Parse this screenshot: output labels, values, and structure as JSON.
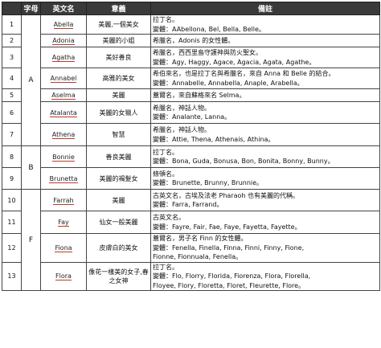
{
  "headers": {
    "num": "",
    "letter": "字母",
    "en": "英文名",
    "meaning": "意義",
    "note": "備註"
  },
  "rows": [
    {
      "num": "1",
      "letter": "A",
      "en": "Abella",
      "meaning": "美麗,一個美女",
      "note": [
        "拉丁名。",
        "變體：AAbellona, Bel, Bella, Belle。"
      ]
    },
    {
      "num": "2",
      "en": "Adonia",
      "meaning": "美麗的小姐",
      "note": [
        "希臘名，Adonis 的女性體。"
      ]
    },
    {
      "num": "3",
      "en": "Agatha",
      "meaning": "美好善良",
      "note": [
        "希臘名，西西里島守護神與防火聖女。",
        "變體：Agy, Haggy, Agace, Agacia, Agata, Agathe。"
      ]
    },
    {
      "num": "4",
      "en": "Annabel",
      "meaning": "高雅的美女",
      "note": [
        "希伯來名，也是拉丁名與希臘名，來自 Anna 和 Belle 的結合。",
        "變體：Annabelle, Annabella, Anaple, Arabella。"
      ]
    },
    {
      "num": "5",
      "en": "Aselma",
      "meaning": "美麗",
      "note": [
        "蓋爾名，來自蘇格來名 Selma。"
      ]
    },
    {
      "num": "6",
      "en": "Atalanta",
      "meaning": "美麗的女獵人",
      "note": [
        "希臘名，神話人物。",
        "變體：Analante, Lanna。"
      ]
    },
    {
      "num": "7",
      "en": "Athena",
      "meaning": "智慧",
      "note": [
        "希臘名，神話人物。",
        "變體：Attie, Thena, Athenais, Athina。"
      ]
    },
    {
      "num": "8",
      "letter": "B",
      "en": "Bonnie",
      "meaning": "善良美麗",
      "note": [
        "拉丁名。",
        "變體：Bona, Guda, Bonusa, Bon, Bonita, Bonny, Bunny。"
      ]
    },
    {
      "num": "9",
      "en": "Brunetta",
      "meaning": "美麗的褐髮女",
      "note": [
        "條頓名。",
        "變體：Brunette, Brunny, Brunnie。"
      ]
    },
    {
      "num": "10",
      "letter": "F",
      "en": "Farrah",
      "meaning": "美麗",
      "note": [
        "古英文名，古埃及法老 Pharaoh 也有美麗的代稱。",
        "變體：Farra, Farrand。"
      ]
    },
    {
      "num": "11",
      "en": "Fay",
      "meaning": "仙女一般美麗",
      "note": [
        "古英文名。",
        "變體：Fayre, Fair, Fae, Faye, Fayetta, Fayette。"
      ]
    },
    {
      "num": "12",
      "en": "Fiona",
      "meaning": "皮膚白的美女",
      "note": [
        "蓋爾名，男子名 Finn 的女性體。",
        "變體：Fenella, Finella, Finna, Finni, Finny, Fione,",
        "Fionne, Fionnuala, Fenella。"
      ]
    },
    {
      "num": "13",
      "en": "Flora",
      "meaning": "像花一樣美的女子,春之女神",
      "note": [
        "拉丁名。",
        "變體：Flo, Florry, Florida, Fiorenza, Flora, Florella,",
        "Floyee, Flory, Floretta, Floret, Fleurette, Flore。"
      ]
    }
  ]
}
